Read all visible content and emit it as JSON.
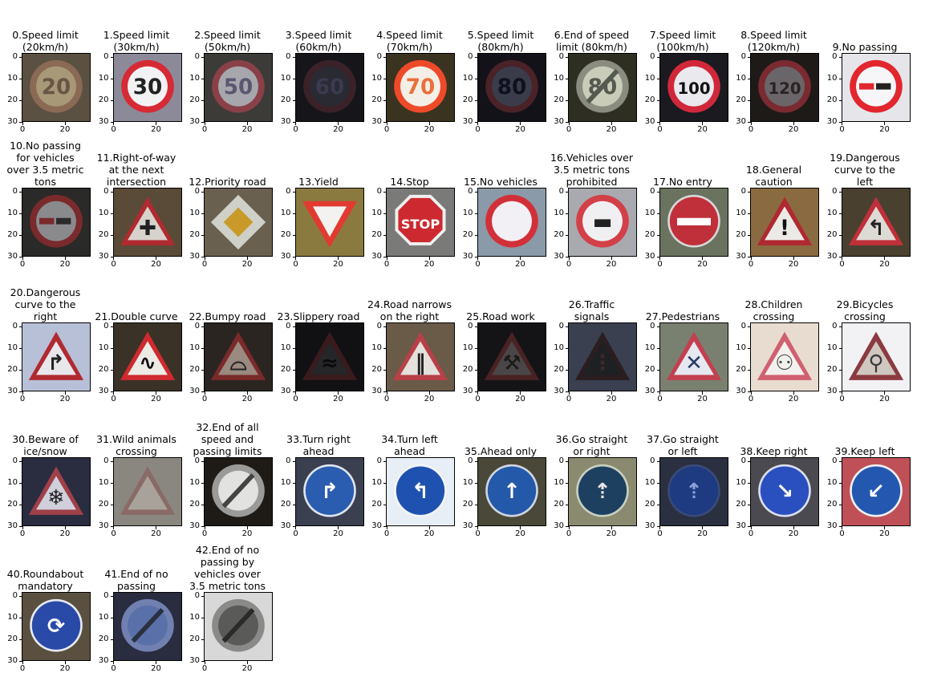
{
  "figure": {
    "ticks": {
      "y": [
        "0",
        "10",
        "20",
        "30"
      ],
      "x": [
        "0",
        "20"
      ]
    },
    "panels": [
      {
        "label": "0.Speed limit\n(20km/h)",
        "icon": "speed-limit-20-sign-icon",
        "shape": "circle",
        "bg": "#5a5142",
        "fill": "#a79878",
        "rim": "#8a6a55",
        "glyph": "20",
        "glyph_color": "#6a5546"
      },
      {
        "label": "1.Speed limit\n(30km/h)",
        "icon": "speed-limit-30-sign-icon",
        "shape": "circle",
        "bg": "#8c8a99",
        "fill": "#f2f2f4",
        "rim": "#d62a35",
        "glyph": "30",
        "glyph_color": "#222222"
      },
      {
        "label": "2.Speed limit\n(50km/h)",
        "icon": "speed-limit-50-sign-icon",
        "shape": "circle",
        "bg": "#3d3b38",
        "fill": "#a7a6ad",
        "rim": "#8a4048",
        "glyph": "50",
        "glyph_color": "#5a5870"
      },
      {
        "label": "3.Speed limit\n(60km/h)",
        "icon": "speed-limit-60-sign-icon",
        "shape": "circle",
        "bg": "#15151a",
        "fill": "#2a2a33",
        "rim": "#3a2228",
        "glyph": "60",
        "glyph_color": "#3a3a50"
      },
      {
        "label": "4.Speed limit\n(70km/h)",
        "icon": "speed-limit-70-sign-icon",
        "shape": "circle",
        "bg": "#3a3320",
        "fill": "#f4efe6",
        "rim": "#ee4a2a",
        "glyph": "70",
        "glyph_color": "#e8703a"
      },
      {
        "label": "5.Speed limit\n(80km/h)",
        "icon": "speed-limit-80-sign-icon",
        "shape": "circle",
        "bg": "#121218",
        "fill": "#3a3c4a",
        "rim": "#4a2228",
        "glyph": "80",
        "glyph_color": "#101020"
      },
      {
        "label": "6.End of speed\nlimit (80km/h)",
        "icon": "end-speed-limit-80-sign-icon",
        "shape": "end",
        "bg": "#2e2f22",
        "fill": "#c9ccb8",
        "rim": "#8a8c80",
        "glyph": "80",
        "glyph_color": "#555a50"
      },
      {
        "label": "7.Speed limit\n(100km/h)",
        "icon": "speed-limit-100-sign-icon",
        "shape": "circle",
        "bg": "#1a1a20",
        "fill": "#e9e9ee",
        "rim": "#d0283a",
        "glyph": "100",
        "glyph_color": "#111111"
      },
      {
        "label": "8.Speed limit\n(120km/h)",
        "icon": "speed-limit-120-sign-icon",
        "shape": "circle",
        "bg": "#1e1a18",
        "fill": "#6a6568",
        "rim": "#7a2a30",
        "glyph": "120",
        "glyph_color": "#2a2224"
      },
      {
        "label": "9.No passing",
        "icon": "no-passing-sign-icon",
        "shape": "nopass",
        "bg": "#e6e6ea",
        "fill": "#f6f6f8",
        "rim": "#e2262e",
        "glyph": "",
        "glyph_color": "#222222"
      },
      {
        "label": "10.No passing\nfor vehicles\nover 3.5 metric\ntons",
        "icon": "no-passing-trucks-sign-icon",
        "shape": "nopass",
        "bg": "#2a2a28",
        "fill": "#8a8a8c",
        "rim": "#7a2a2c",
        "glyph": "",
        "glyph_color": "#2a2a2a"
      },
      {
        "label": "11.Right-of-way\nat the next\nintersection",
        "icon": "right-of-way-sign-icon",
        "shape": "triangle",
        "bg": "#5a4a38",
        "fill": "#d8d2cc",
        "rim": "#b02a30",
        "glyph": "✚",
        "glyph_color": "#222222"
      },
      {
        "label": "12.Priority road",
        "icon": "priority-road-sign-icon",
        "shape": "diamond",
        "bg": "#6a6050",
        "fill": "#e8e2d8",
        "rim": "#cfd0c8",
        "glyph": "",
        "glyph_color": "#c99a2a"
      },
      {
        "label": "13.Yield",
        "icon": "yield-sign-icon",
        "shape": "yield",
        "bg": "#8a7a40",
        "fill": "#f4f2f0",
        "rim": "#e23a30",
        "glyph": "",
        "glyph_color": "#222222"
      },
      {
        "label": "14.Stop",
        "icon": "stop-sign-icon",
        "shape": "octagon",
        "bg": "#7a7a78",
        "fill": "#cc2a30",
        "rim": "#f0f0f0",
        "glyph": "STOP",
        "glyph_color": "#ffffff"
      },
      {
        "label": "15.No vehicles",
        "icon": "no-vehicles-sign-icon",
        "shape": "circle",
        "bg": "#8a9aa8",
        "fill": "#f2f0f4",
        "rim": "#d23038",
        "glyph": "",
        "glyph_color": "#222222"
      },
      {
        "label": "16.Vehicles over\n3.5 metric tons\nprohibited",
        "icon": "no-trucks-sign-icon",
        "shape": "circle",
        "bg": "#a8aab0",
        "fill": "#f0f0f2",
        "rim": "#d24048",
        "glyph": "▬",
        "glyph_color": "#222222"
      },
      {
        "label": "17.No entry",
        "icon": "no-entry-sign-icon",
        "shape": "noentry",
        "bg": "#6a7260",
        "fill": "#c0303a",
        "rim": "#d8d8d8",
        "glyph": "",
        "glyph_color": "#ffffff"
      },
      {
        "label": "18.General\ncaution",
        "icon": "general-caution-sign-icon",
        "shape": "triangle",
        "bg": "#8a6a40",
        "fill": "#eceae6",
        "rim": "#b02830",
        "glyph": "!",
        "glyph_color": "#111111"
      },
      {
        "label": "19.Dangerous\ncurve to the\nleft",
        "icon": "curve-left-sign-icon",
        "shape": "triangle",
        "bg": "#4a4030",
        "fill": "#dedad4",
        "rim": "#c0303a",
        "glyph": "↰",
        "glyph_color": "#222222"
      },
      {
        "label": "20.Dangerous\ncurve to the\nright",
        "icon": "curve-right-sign-icon",
        "shape": "triangle",
        "bg": "#b8c0d8",
        "fill": "#e8e8ec",
        "rim": "#b02a30",
        "glyph": "↱",
        "glyph_color": "#222222"
      },
      {
        "label": "21.Double curve",
        "icon": "double-curve-sign-icon",
        "shape": "triangle",
        "bg": "#3a3226",
        "fill": "#ecebe6",
        "rim": "#d02a30",
        "glyph": "∿",
        "glyph_color": "#111111"
      },
      {
        "label": "22.Bumpy road",
        "icon": "bumpy-road-sign-icon",
        "shape": "triangle",
        "bg": "#2a2520",
        "fill": "#9a8a80",
        "rim": "#7a2a2a",
        "glyph": "⌓",
        "glyph_color": "#222222"
      },
      {
        "label": "23.Slippery road",
        "icon": "slippery-road-sign-icon",
        "shape": "triangle",
        "bg": "#111114",
        "fill": "#262528",
        "rim": "#3a1a1c",
        "glyph": "≈",
        "glyph_color": "#0a0a0a"
      },
      {
        "label": "24.Road narrows\non the right",
        "icon": "road-narrows-right-sign-icon",
        "shape": "triangle",
        "bg": "#6a5a48",
        "fill": "#e4e0dc",
        "rim": "#b84048",
        "glyph": "‖",
        "glyph_color": "#222222"
      },
      {
        "label": "25.Road work",
        "icon": "road-work-sign-icon",
        "shape": "triangle",
        "bg": "#141416",
        "fill": "#4a4648",
        "rim": "#4a2224",
        "glyph": "⚒",
        "glyph_color": "#1a1a1a"
      },
      {
        "label": "26.Traffic\nsignals",
        "icon": "traffic-signals-sign-icon",
        "shape": "triangle",
        "bg": "#3a4050",
        "fill": "#1e2024",
        "rim": "#2a1e20",
        "glyph": "⋮",
        "glyph_color": "#3a2a2a"
      },
      {
        "label": "27.Pedestrians",
        "icon": "pedestrians-sign-icon",
        "shape": "triangle",
        "bg": "#7a8070",
        "fill": "#e6e8f0",
        "rim": "#c24050",
        "glyph": "✕",
        "glyph_color": "#2a3a6a"
      },
      {
        "label": "28.Children\ncrossing",
        "icon": "children-crossing-sign-icon",
        "shape": "triangle",
        "bg": "#e8dcd0",
        "fill": "#f4f0ee",
        "rim": "#d06070",
        "glyph": "⚇",
        "glyph_color": "#3a4a3a"
      },
      {
        "label": "29.Bicycles\ncrossing",
        "icon": "bicycles-crossing-sign-icon",
        "shape": "triangle",
        "bg": "#f2f2f4",
        "fill": "#d0c8c0",
        "rim": "#8a3a40",
        "glyph": "⚲",
        "glyph_color": "#3a3a3a"
      },
      {
        "label": "30.Beware of\nice/snow",
        "icon": "ice-snow-sign-icon",
        "shape": "triangle",
        "bg": "#2a2c40",
        "fill": "#cfd0dc",
        "rim": "#a04048",
        "glyph": "❄",
        "glyph_color": "#222222"
      },
      {
        "label": "31.Wild animals\ncrossing",
        "icon": "wild-animals-sign-icon",
        "shape": "triangle",
        "bg": "#8a8680",
        "fill": "#a8a29a",
        "rim": "#8a6a66",
        "glyph": "",
        "glyph_color": "#6a6460"
      },
      {
        "label": "32.End of all\nspeed and\npassing limits",
        "icon": "end-all-limits-sign-icon",
        "shape": "end",
        "bg": "#1e1a16",
        "fill": "#e2e2e0",
        "rim": "#9a9a98",
        "glyph": "",
        "glyph_color": "#444444"
      },
      {
        "label": "33.Turn right\nahead",
        "icon": "turn-right-ahead-sign-icon",
        "shape": "blue",
        "bg": "#3a4050",
        "fill": "#2a5cb0",
        "rim": "#dfe4ee",
        "glyph": "↱",
        "glyph_color": "#ffffff"
      },
      {
        "label": "34.Turn left\nahead",
        "icon": "turn-left-ahead-sign-icon",
        "shape": "blue",
        "bg": "#e8eef6",
        "fill": "#1f52b0",
        "rim": "#f2f4f8",
        "glyph": "↰",
        "glyph_color": "#ffffff"
      },
      {
        "label": "35.Ahead only",
        "icon": "ahead-only-sign-icon",
        "shape": "blue",
        "bg": "#4a4838",
        "fill": "#2458a8",
        "rim": "#cfd6e2",
        "glyph": "↑",
        "glyph_color": "#ffffff"
      },
      {
        "label": "36.Go straight\nor right",
        "icon": "straight-or-right-sign-icon",
        "shape": "blue",
        "bg": "#8a8a70",
        "fill": "#1e4060",
        "rim": "#c8d0c0",
        "glyph": "⇡",
        "glyph_color": "#e8e8e8"
      },
      {
        "label": "37.Go straight\nor left",
        "icon": "straight-or-left-sign-icon",
        "shape": "blue",
        "bg": "#2a3040",
        "fill": "#1e3a80",
        "rim": "#3a4a78",
        "glyph": "⇡",
        "glyph_color": "#8aa0d8"
      },
      {
        "label": "38.Keep right",
        "icon": "keep-right-sign-icon",
        "shape": "blue",
        "bg": "#4a4a50",
        "fill": "#2a50c0",
        "rim": "#dcdff0",
        "glyph": "↘",
        "glyph_color": "#ffffff"
      },
      {
        "label": "39.Keep left",
        "icon": "keep-left-sign-icon",
        "shape": "blue",
        "bg": "#c05058",
        "fill": "#2458b0",
        "rim": "#f0f0f4",
        "glyph": "↙",
        "glyph_color": "#ffffff"
      },
      {
        "label": "40.Roundabout\nmandatory",
        "icon": "roundabout-sign-icon",
        "shape": "blue",
        "bg": "#5a5040",
        "fill": "#2a4aa8",
        "rim": "#e8eaf2",
        "glyph": "⟳",
        "glyph_color": "#ffffff"
      },
      {
        "label": "41.End of no\npassing",
        "icon": "end-no-passing-sign-icon",
        "shape": "end",
        "bg": "#2a2c40",
        "fill": "#5a70a8",
        "rim": "#7080b0",
        "glyph": "",
        "glyph_color": "#2a3040"
      },
      {
        "label": "42.End of no\npassing by\nvehicles over\n3.5 metric tons",
        "icon": "end-no-passing-trucks-sign-icon",
        "shape": "end",
        "bg": "#d8d8d8",
        "fill": "#5a5a58",
        "rim": "#8a8a88",
        "glyph": "",
        "glyph_color": "#2a2a2a"
      }
    ]
  }
}
